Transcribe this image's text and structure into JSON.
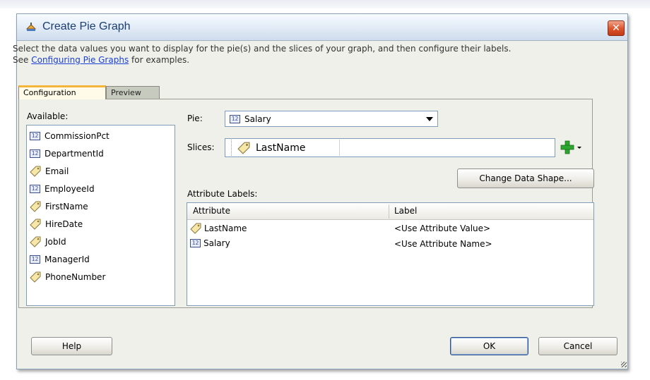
{
  "dialog": {
    "title": "Create Pie Graph",
    "close_label": "✕",
    "instruction_line1": "Select the data values you want to display for the pie(s) and the slices of your graph, and then configure their labels.",
    "instruction_see": "See",
    "instruction_link": "Configuring Pie Graphs",
    "instruction_after": "for examples."
  },
  "tabs": [
    {
      "label": "Configuration",
      "active": true
    },
    {
      "label": "Preview",
      "active": false
    }
  ],
  "available": {
    "label": "Available:",
    "items": [
      {
        "label": "CommissionPct",
        "icon": "number-attribute-icon"
      },
      {
        "label": "DepartmentId",
        "icon": "number-attribute-icon"
      },
      {
        "label": "Email",
        "icon": "tag-attribute-icon"
      },
      {
        "label": "EmployeeId",
        "icon": "number-attribute-icon"
      },
      {
        "label": "FirstName",
        "icon": "tag-attribute-icon"
      },
      {
        "label": "HireDate",
        "icon": "tag-attribute-icon"
      },
      {
        "label": "JobId",
        "icon": "tag-attribute-icon"
      },
      {
        "label": "ManagerId",
        "icon": "number-attribute-icon"
      },
      {
        "label": "PhoneNumber",
        "icon": "tag-attribute-icon"
      }
    ]
  },
  "pie": {
    "label": "Pie:",
    "selected_value": "Salary",
    "icon": "number-attribute-icon"
  },
  "slices": {
    "label": "Slices:",
    "chip_label": "LastName",
    "icon": "tag-attribute-icon"
  },
  "change_data_shape_label": "Change Data Shape...",
  "attribute_labels": {
    "label": "Attribute Labels:",
    "columns": [
      "Attribute",
      "Label"
    ],
    "rows": [
      {
        "attribute": "LastName",
        "label": "<Use Attribute Value>",
        "icon": "tag-attribute-icon"
      },
      {
        "attribute": "Salary",
        "label": "<Use Attribute Name>",
        "icon": "number-attribute-icon"
      }
    ]
  },
  "buttons": {
    "help": "Help",
    "ok": "OK",
    "cancel": "Cancel"
  },
  "colors": {
    "title_text": "#1b3e72",
    "close_button": "#d9532b",
    "active_tab_accent": "#f5b43a",
    "link": "#1a3fd6",
    "add_icon": "#2ea52e"
  }
}
